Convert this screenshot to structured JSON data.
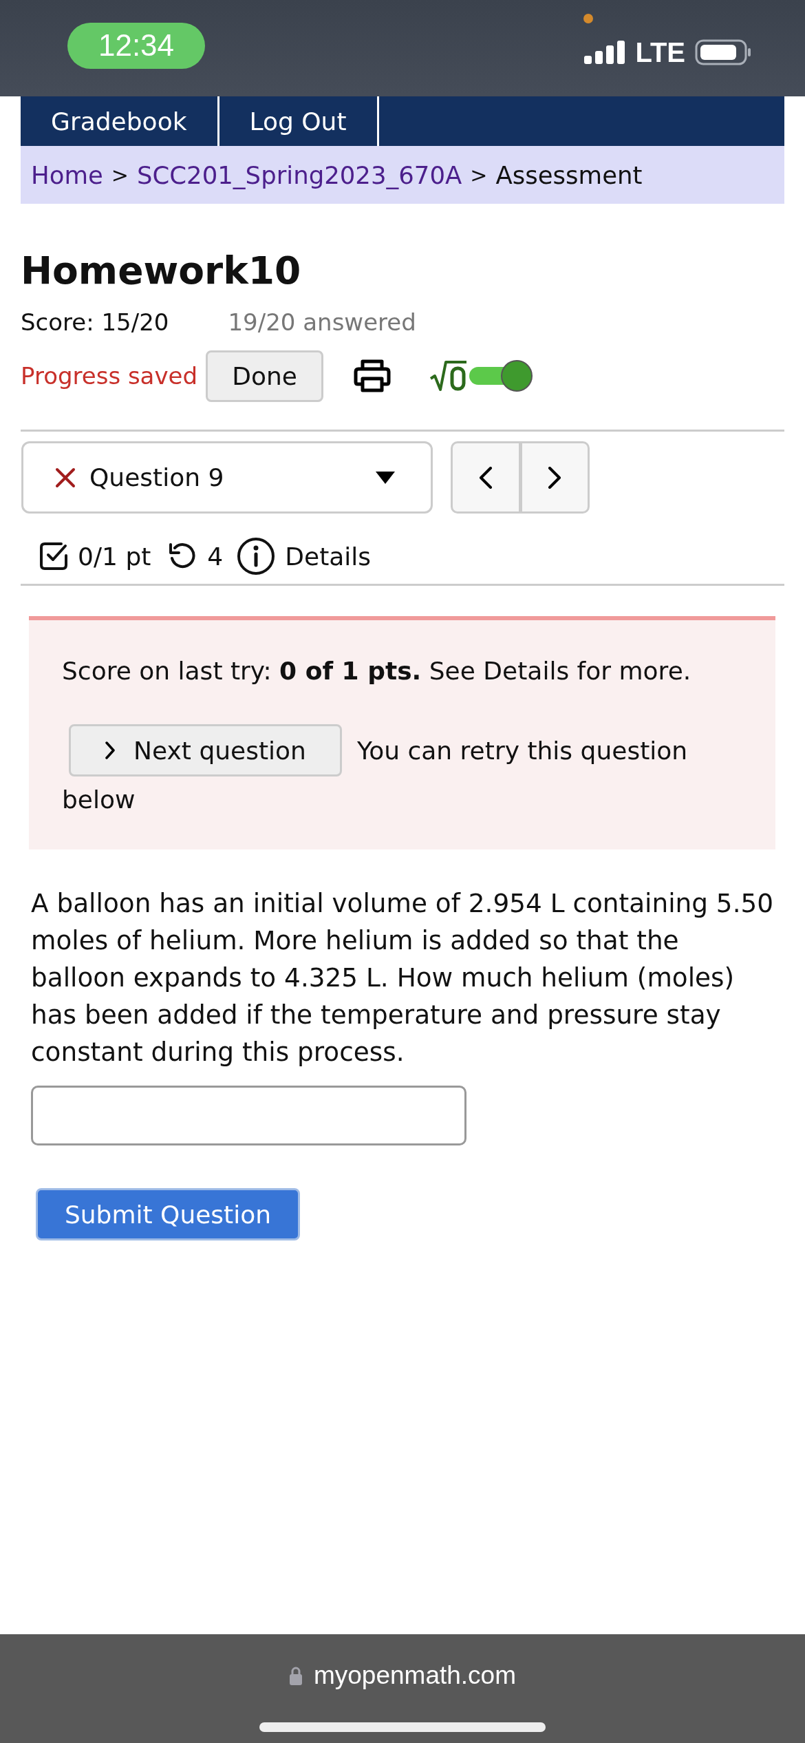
{
  "status_bar": {
    "time": "12:34",
    "network": "LTE"
  },
  "nav": {
    "items": [
      {
        "label": "Gradebook"
      },
      {
        "label": "Log Out"
      }
    ]
  },
  "breadcrumb": [
    {
      "kind": "link",
      "label": "Home"
    },
    {
      "kind": "separator",
      "label": ">"
    },
    {
      "kind": "link",
      "label": "SCC201_Spring2023_670A"
    },
    {
      "kind": "separator",
      "label": ">"
    },
    {
      "kind": "current",
      "label": "Assessment"
    }
  ],
  "assessment": {
    "title": "Homework10",
    "score": "Score: 15/20",
    "answered": "19/20 answered",
    "progress": "Progress saved",
    "done_button": "Done",
    "math_toggle": {
      "on": true
    }
  },
  "question_nav": {
    "label": "Question 9",
    "correct": false
  },
  "question_meta": {
    "points": "0/1 pt",
    "tries": "4",
    "details": "Details"
  },
  "feedback": {
    "text": "Score on last try: **0 of 1 pts.** See Details for more.",
    "next_button": "Next question",
    "retry_lines": [
      "You can retry this question",
      "below"
    ]
  },
  "question": {
    "text": "A balloon has an initial volume of 2.954 L containing 5.50 moles of helium. More helium is added so that the balloon expands to 4.325 L. How much helium (moles) has been added if the temperature and pressure stay constant during this process.",
    "submit_button": "Submit Question"
  },
  "browser": {
    "url": "myopenmath.com"
  }
}
